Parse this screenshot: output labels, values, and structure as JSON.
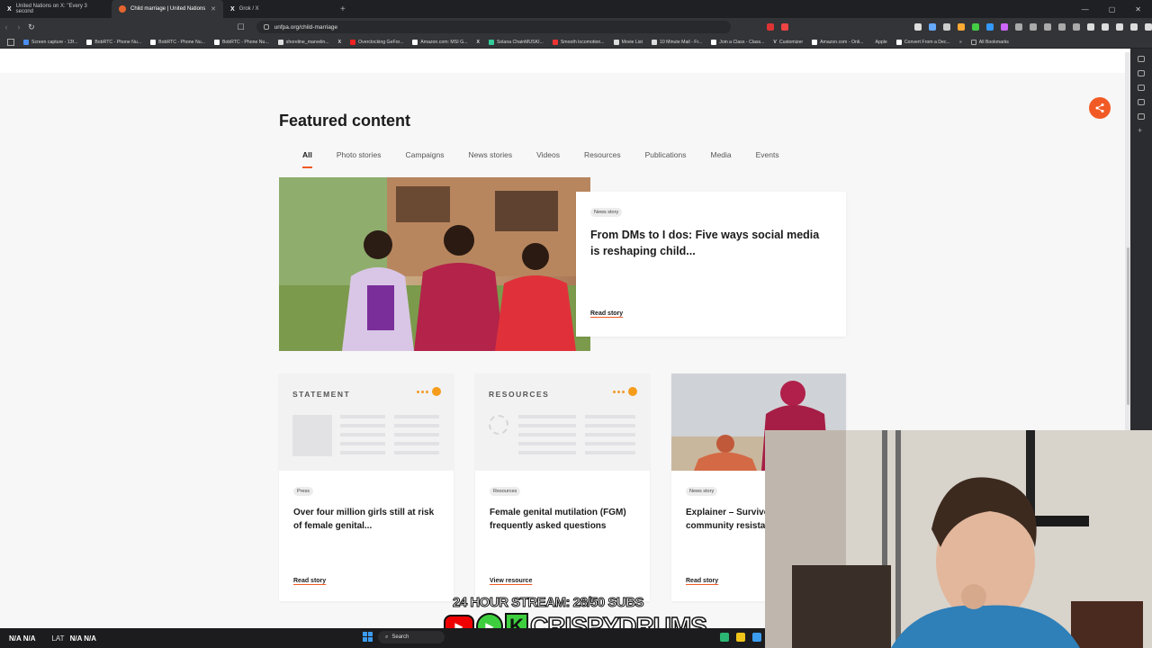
{
  "browser": {
    "tabs": [
      {
        "label": "United Nations on X: \"Every 3 second",
        "icon": "x-icon",
        "active": false
      },
      {
        "label": "Child marriage | United Nations",
        "icon": "unfpa-icon",
        "active": true
      },
      {
        "label": "Grok / X",
        "icon": "x-icon",
        "active": false
      }
    ],
    "url": "unfpa.org/child-marriage",
    "bookmarks": [
      "Screen capture - 13f...",
      "BobRTC - Phone Nu...",
      "BobRTC - Phone Nu...",
      "BobRTC - Phone Nu...",
      "shoreline_marvelin...",
      "",
      "Overclocking GeFor...",
      "Amazon.com: MSI G...",
      "",
      "Solana ChainMUSKI...",
      "Smooth locomotion...",
      "Movie List",
      "10 Minute Mail - Fr...",
      "Join a Class - Class...",
      "Customizer",
      "Amazon.com - Onli...",
      "Apple",
      "Convert From a Dec..."
    ],
    "all_bookmarks": "All Bookmarks"
  },
  "featured": {
    "title": "Featured content",
    "filters": [
      "All",
      "Photo stories",
      "Campaigns",
      "News stories",
      "Videos",
      "Resources",
      "Publications",
      "Media",
      "Events"
    ],
    "active_filter": "All",
    "hero": {
      "badge": "News story",
      "title": "From DMs to I dos: Five ways social media is reshaping child...",
      "link": "Read story"
    },
    "cards": [
      {
        "thumb_label": "STATEMENT",
        "badge": "Press",
        "title": "Over four million girls still at risk of female genital...",
        "link": "Read story"
      },
      {
        "thumb_label": "RESOURCES",
        "badge": "Resources",
        "title": "Female genital mutilation (FGM) frequently asked questions",
        "link": "View resource"
      },
      {
        "thumb_label": "",
        "badge": "News story",
        "title": "Explainer – Survivors lead: How community resistance is...",
        "link": "Read story"
      }
    ]
  },
  "stream": {
    "headline": "24 HOUR STREAM: 28/50 SUBS",
    "brand": "CRISPYDRUMS",
    "k": "K"
  },
  "taskbar": {
    "left": "N/A  N/A",
    "lat_label": "LAT",
    "lat_values": "N/A  N/A",
    "search": "Search"
  },
  "colors": {
    "accent": "#f15a24",
    "tabbar": "#1f2023",
    "chrome": "#333437"
  }
}
